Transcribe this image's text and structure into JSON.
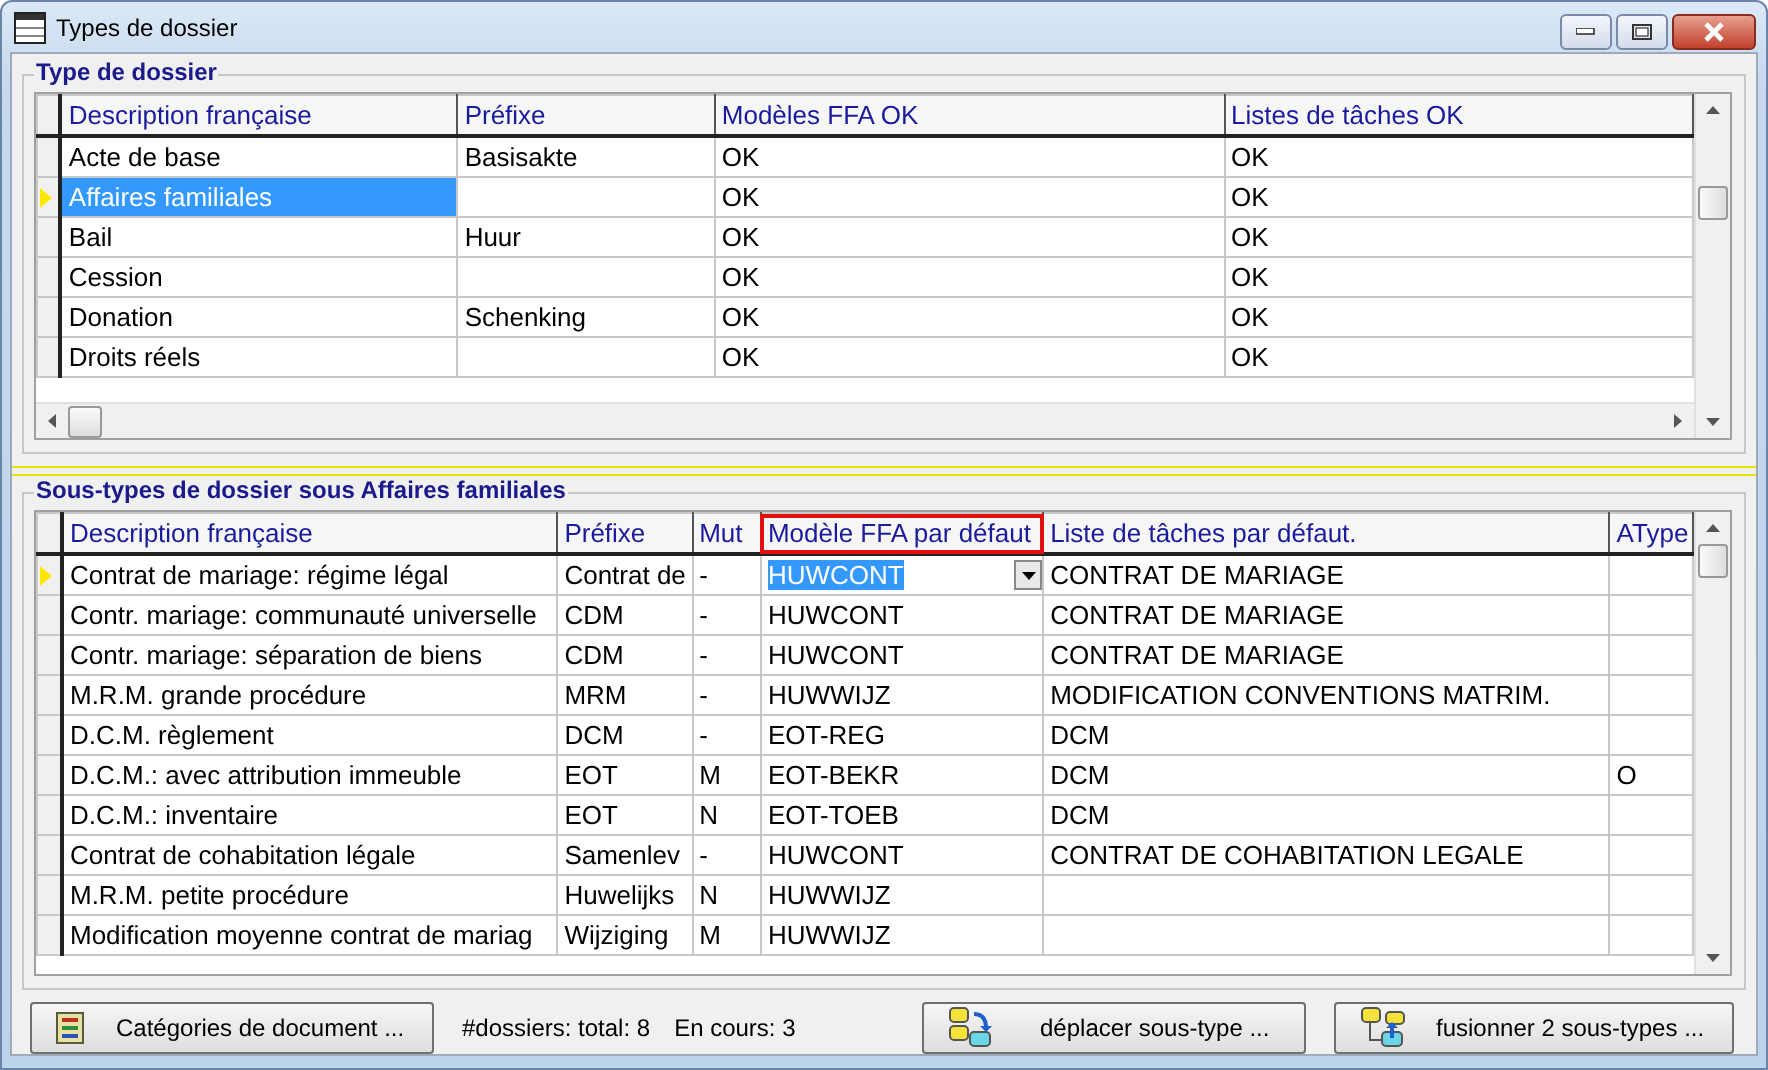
{
  "window": {
    "title": "Types de dossier"
  },
  "types": {
    "title": "Type de dossier",
    "columns": [
      {
        "label": "Description française"
      },
      {
        "label": "Préfixe"
      },
      {
        "label": "Modèles FFA OK"
      },
      {
        "label": "Listes de tâches OK"
      }
    ],
    "rows": [
      {
        "description": "Acte de base",
        "prefix": "Basisakte",
        "models": "OK",
        "tasks": "OK",
        "selected": false
      },
      {
        "description": "Affaires familiales",
        "models": "OK",
        "tasks": "OK",
        "selected": true
      },
      {
        "description": "Bail",
        "prefix": "Huur",
        "models": "OK",
        "tasks": "OK",
        "selected": false
      },
      {
        "description": "Cession",
        "models": "OK",
        "tasks": "OK",
        "selected": false
      },
      {
        "description": "Donation",
        "prefix": "Schenking",
        "models": "OK",
        "tasks": "OK",
        "selected": false
      },
      {
        "description": "Droits réels",
        "models": "OK",
        "tasks": "OK",
        "selected": false
      }
    ]
  },
  "subtypes": {
    "title": "Sous-types de dossier sous Affaires familiales",
    "columns": [
      {
        "label": "Description française",
        "kind": "text",
        "highlighted": false
      },
      {
        "label": "Préfixe",
        "kind": "text",
        "highlighted": false
      },
      {
        "label": "Mut",
        "kind": "text",
        "highlighted": false
      },
      {
        "label": "Modèle FFA par défaut",
        "kind": "dropdown",
        "highlighted": true
      },
      {
        "label": "Liste de tâches par défaut.",
        "kind": "text",
        "highlighted": false
      },
      {
        "label": "AType",
        "kind": "text",
        "highlighted": false
      }
    ],
    "rows": [
      {
        "description": "Contrat de mariage: régime légal",
        "prefix": "Contrat de",
        "mut": "-",
        "model": "HUWCONT",
        "tasks": "CONTRAT DE MARIAGE",
        "selected": true
      },
      {
        "description": "Contr. mariage: communauté universelle",
        "prefix": "CDM",
        "mut": "-",
        "model": "HUWCONT",
        "tasks": "CONTRAT DE MARIAGE",
        "selected": false
      },
      {
        "description": "Contr. mariage: séparation de biens",
        "prefix": "CDM",
        "mut": "-",
        "model": "HUWCONT",
        "tasks": "CONTRAT DE MARIAGE",
        "selected": false
      },
      {
        "description": "M.R.M. grande procédure",
        "prefix": "MRM",
        "mut": "-",
        "model": "HUWWIJZ",
        "tasks": "MODIFICATION CONVENTIONS MATRIM.",
        "selected": false
      },
      {
        "description": "D.C.M. règlement",
        "prefix": "DCM",
        "mut": "-",
        "model": "EOT-REG",
        "tasks": "DCM",
        "selected": false
      },
      {
        "description": "D.C.M.: avec attribution immeuble",
        "prefix": "EOT",
        "mut": "M",
        "model": "EOT-BEKR",
        "tasks": "DCM",
        "atype": "O",
        "selected": false
      },
      {
        "description": "D.C.M.: inventaire",
        "prefix": "EOT",
        "mut": "N",
        "model": "EOT-TOEB",
        "tasks": "DCM",
        "selected": false
      },
      {
        "description": "Contrat de cohabitation légale",
        "prefix": "Samenlev",
        "mut": "-",
        "model": "HUWCONT",
        "tasks": "CONTRAT DE COHABITATION LEGALE",
        "selected": false
      },
      {
        "description": "M.R.M. petite procédure",
        "prefix": "Huwelijks",
        "mut": "N",
        "model": "HUWWIJZ",
        "selected": false
      },
      {
        "description": "Modification moyenne contrat de mariag",
        "prefix": "Wijziging",
        "mut": "M",
        "model": "HUWWIJZ",
        "selected": false
      }
    ]
  },
  "footer": {
    "buttons": [
      {
        "label": "Catégories de document ...",
        "kind": "categories"
      },
      {
        "label": "déplacer sous-type ...",
        "kind": "move"
      },
      {
        "label": "fusionner 2 sous-types ...",
        "kind": "merge"
      }
    ],
    "total": "#dossiers:  total: 8",
    "in_progress": "En cours: 3"
  }
}
